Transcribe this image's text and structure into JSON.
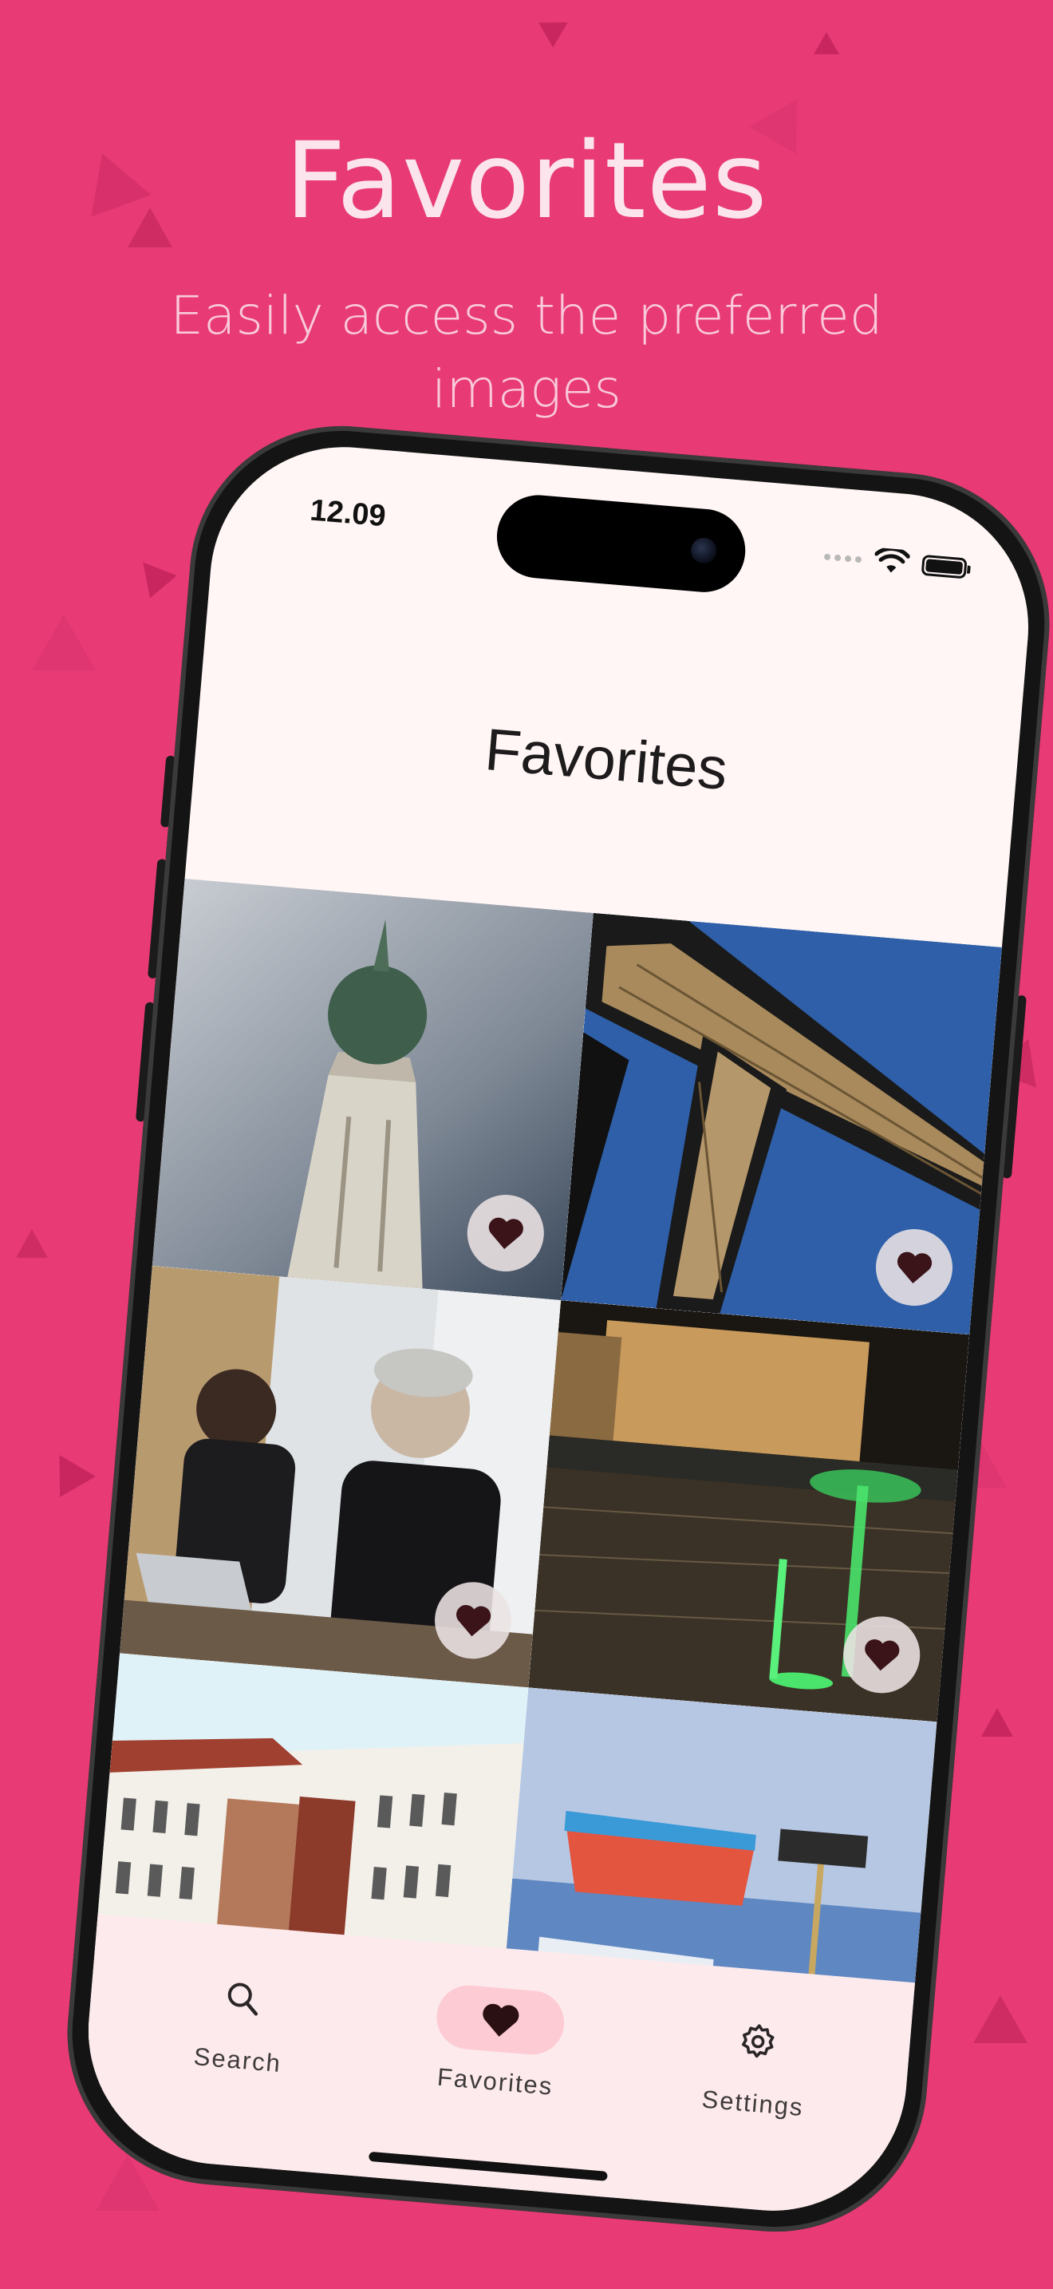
{
  "banner": {
    "title": "Favorites",
    "subtitle_line1": "Easily access the preferred",
    "subtitle_line2": "images"
  },
  "status_bar": {
    "time": "12.09"
  },
  "app": {
    "title": "Favorites",
    "tiles": [
      {
        "subject": "obelisk-top",
        "favorited": true
      },
      {
        "subject": "eiffel-tower-underside",
        "favorited": true
      },
      {
        "subject": "people-working-laptops",
        "favorited": true
      },
      {
        "subject": "illuminated-fountain-night",
        "favorited": true
      },
      {
        "subject": "venice-buildings",
        "favorited": false
      },
      {
        "subject": "boats-on-water",
        "favorited": false
      }
    ],
    "nav": {
      "items": [
        {
          "label": "Search",
          "icon": "search-icon",
          "active": false
        },
        {
          "label": "Favorites",
          "icon": "heart-icon",
          "active": true
        },
        {
          "label": "Settings",
          "icon": "gear-icon",
          "active": false
        }
      ]
    }
  },
  "colors": {
    "background": "#e83b76",
    "screen": "#fff6f5",
    "nav_bg": "#fdeaec",
    "active_pill": "#fdcbd4",
    "heart": "#3a1418"
  }
}
